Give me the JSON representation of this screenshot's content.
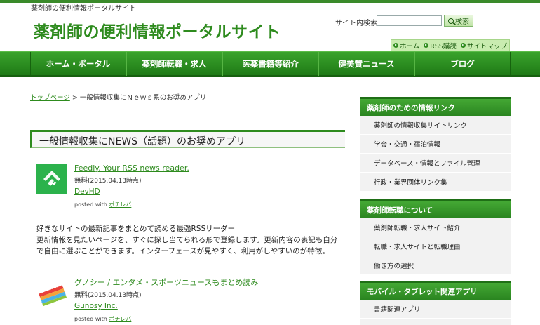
{
  "header": {
    "tagline": "薬剤師の便利情報ポータルサイト",
    "site_title": "薬剤師の便利情報ポータルサイト",
    "search_label": "サイト内検索:",
    "search_value": "",
    "search_button": "検索"
  },
  "utility_links": [
    "ホーム",
    "RSS購読",
    "サイトマップ"
  ],
  "global_nav": [
    "ホーム・ポータル",
    "薬剤師転職・求人",
    "医薬書籍等紹介",
    "健美賛ニュース",
    "ブログ"
  ],
  "breadcrumb": {
    "home": "トップページ",
    "separator": ">",
    "current": "一般情報収集にＮｅｗｓ系のお奨めアプリ"
  },
  "section_title": "一般情報収集にNEWS（話題）のお奨めアプリ",
  "apps": [
    {
      "name": "Feedly. Your RSS news reader.",
      "price": "無料",
      "date": "(2015.04.13時点)",
      "developer": "DevHD",
      "posted_with": "posted with",
      "posted_link": "ポチレバ"
    },
    {
      "name": "グノシー / エンタメ・スポーツニュースもまとめ読み",
      "price": "無料",
      "date": "(2015.04.13時点)",
      "developer": "Gunosy Inc.",
      "posted_with": "posted with",
      "posted_link": "ポチレバ"
    }
  ],
  "description": [
    "好きなサイトの最新記事をまとめて読める最強RSSリーダー",
    "更新情報を見たいページを、すぐに探し当てられる形で登録します。更新内容の表記も自分",
    "で自由に選ぶことができます。インターフェースが見やすく、利用がしやすいのが特徴。"
  ],
  "sidebar": [
    {
      "title": "薬剤師のための情報リンク",
      "items": [
        "薬剤師の情報収集サイトリンク",
        "学会・交通・宿泊情報",
        "データベース・情報とファイル管理",
        "行政・業界団体リンク集"
      ]
    },
    {
      "title": "薬剤師転職について",
      "items": [
        "薬剤師転職・求人サイト紹介",
        "転職・求人サイトと転職理由",
        "働き方の選択"
      ]
    },
    {
      "title": "モバイル・タブレット関連アプリ",
      "items": [
        "書籍関連アプリ",
        ""
      ]
    }
  ],
  "colors": {
    "brand_green": "#2e8b1e",
    "nav_green": "#2a8520",
    "feedly_green": "#2bb24c"
  }
}
